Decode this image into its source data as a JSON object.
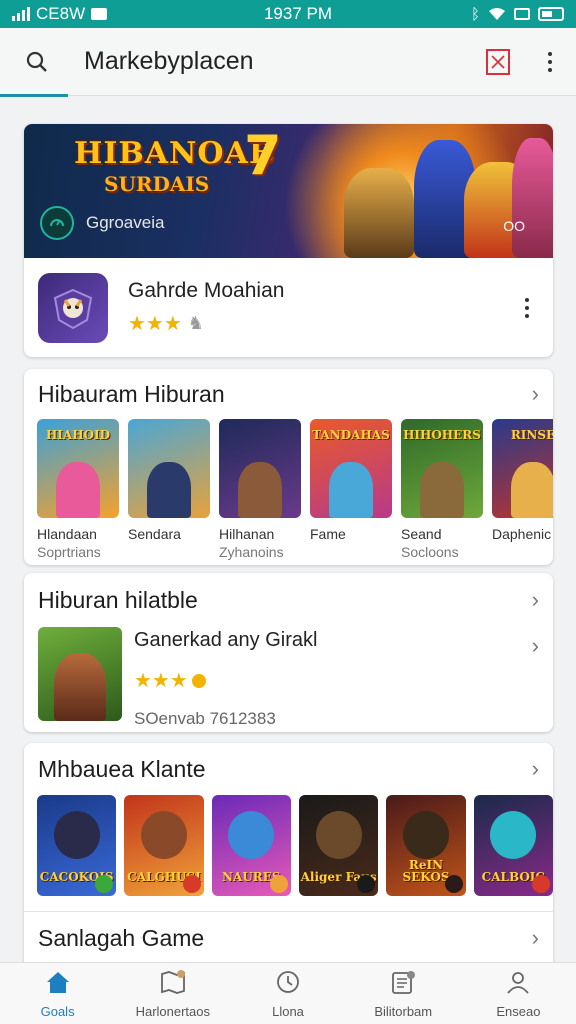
{
  "status_bar": {
    "carrier": "CE8W",
    "time": "1937 PM"
  },
  "app_bar": {
    "title": "Markebyplacen"
  },
  "featured": {
    "banner_title_line1": "HIBANOAB",
    "banner_title_line2": "SURDAIS",
    "banner_title_number": "7",
    "banner_label": "Ggroaveia",
    "banner_corner": "OO",
    "app_name": "Gahrde Moahian",
    "rating_stars": "★★★"
  },
  "section1": {
    "title": "Hibauram Hiburan",
    "tiles": [
      {
        "art_text": "HIAHOID",
        "name": "Hlandaan",
        "sub": "Soprtrians",
        "colors": [
          "#3aa1d8",
          "#f7a12b"
        ],
        "fig": "#e85a9a"
      },
      {
        "art_text": "",
        "name": "Sendara",
        "sub": "",
        "colors": [
          "#4aa6d6",
          "#e8a23a"
        ],
        "fig": "#2a3a6a"
      },
      {
        "art_text": "",
        "name": "Hilhanan",
        "sub": "Zyhanoins",
        "colors": [
          "#1f2a5a",
          "#6a3a8a"
        ],
        "fig": "#8a5a3a"
      },
      {
        "art_text": "TANDAHAS",
        "name": "Fame",
        "sub": "",
        "colors": [
          "#e95a2a",
          "#b73a8a"
        ],
        "fig": "#4aa8d8"
      },
      {
        "art_text": "HIHOHERS",
        "name": "Seand",
        "sub": "Socloons",
        "colors": [
          "#2e6a2a",
          "#6fa83a"
        ],
        "fig": "#8a6a3a"
      },
      {
        "art_text": "RINSE",
        "name": "Daphenic",
        "sub": "",
        "colors": [
          "#2a3a8a",
          "#c2342a"
        ],
        "fig": "#e8b04a"
      }
    ]
  },
  "section2": {
    "title": "Hiburan hilatble",
    "item": {
      "name": "Ganerkad any Girakl",
      "rating_stars": "★★★",
      "meta": "SOenvab 7612383"
    }
  },
  "section3": {
    "title": "Mhbauea Klante",
    "tiles": [
      {
        "art_text": "CACOKOIS",
        "colors": [
          "#1a3a8a",
          "#3a6ad8"
        ],
        "fig": "#2a2a4a",
        "chip": "#3aa83a"
      },
      {
        "art_text": "CALGHUSI",
        "colors": [
          "#c2341a",
          "#f0a23a"
        ],
        "fig": "#8a4a2a",
        "chip": "#d83a2a"
      },
      {
        "art_text": "NAURES",
        "colors": [
          "#6a2ab8",
          "#e85ab8"
        ],
        "fig": "#3a8ad8",
        "chip": "#f0a23a"
      },
      {
        "art_text": "Aliger Faus",
        "colors": [
          "#1a1a1a",
          "#4a2a1a"
        ],
        "fig": "#6a4a2a",
        "chip": "#1a1a1a"
      },
      {
        "art_text": "ReIN SEKOS",
        "colors": [
          "#4a1a1a",
          "#c2541a"
        ],
        "fig": "#3a2a1a",
        "chip": "#2a1a1a"
      },
      {
        "art_text": "CALBOIC",
        "colors": [
          "#1a2a4a",
          "#8a2a8a"
        ],
        "fig": "#2ab8c8",
        "chip": "#d83a2a"
      }
    ]
  },
  "section4": {
    "title": "Sanlagah Game"
  },
  "bottom_nav": [
    {
      "label": "Goals",
      "icon": "home-icon",
      "active": true
    },
    {
      "label": "Harlonertaos",
      "icon": "map-icon",
      "active": false
    },
    {
      "label": "Llona",
      "icon": "clock-icon",
      "active": false
    },
    {
      "label": "Bilitorbam",
      "icon": "list-icon",
      "active": false
    },
    {
      "label": "Enseao",
      "icon": "person-icon",
      "active": false
    }
  ],
  "colors": {
    "status_bar": "#0f9e96",
    "accent": "#1e7fc0",
    "star": "#f2b400"
  }
}
